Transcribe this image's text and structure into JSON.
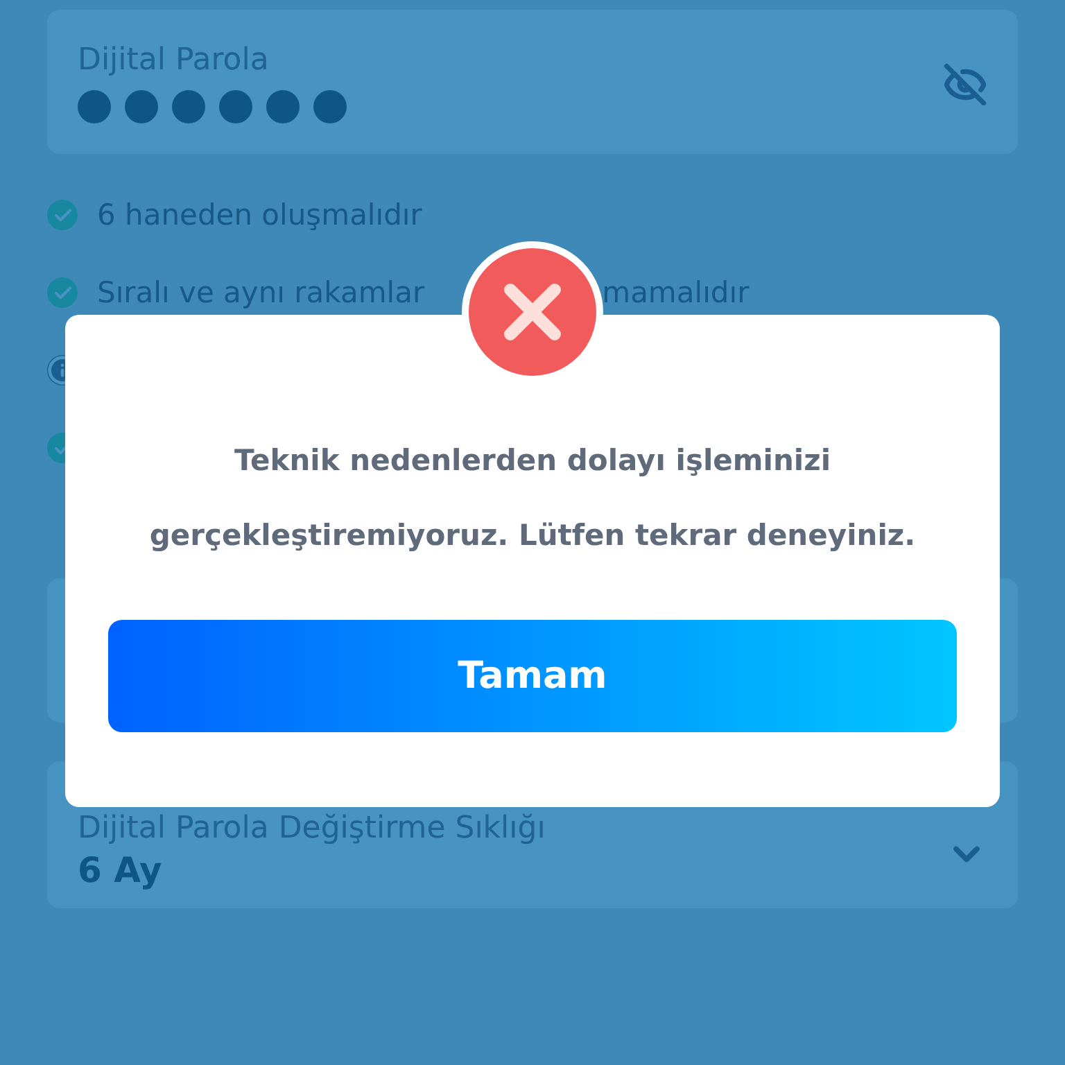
{
  "password_field": {
    "label": "Dijital Parola",
    "visible": false
  },
  "rules": [
    {
      "kind": "check",
      "parts": [
        "6 haneden oluşmalıdır"
      ]
    },
    {
      "kind": "check",
      "parts": [
        "Sıralı ve aynı rakamlar",
        "mamalıdır"
      ]
    },
    {
      "kind": "info"
    },
    {
      "kind": "check"
    }
  ],
  "frequency_select": {
    "label": "Dijital Parola Değiştirme Sıklığı",
    "value": "6 Ay"
  },
  "dialog": {
    "kind": "error",
    "lines": [
      "Teknik nedenlerden dolayı işleminizi",
      "gerçekleştiremiyoruz. Lütfen tekrar deneyiniz."
    ],
    "button": "Tamam"
  }
}
